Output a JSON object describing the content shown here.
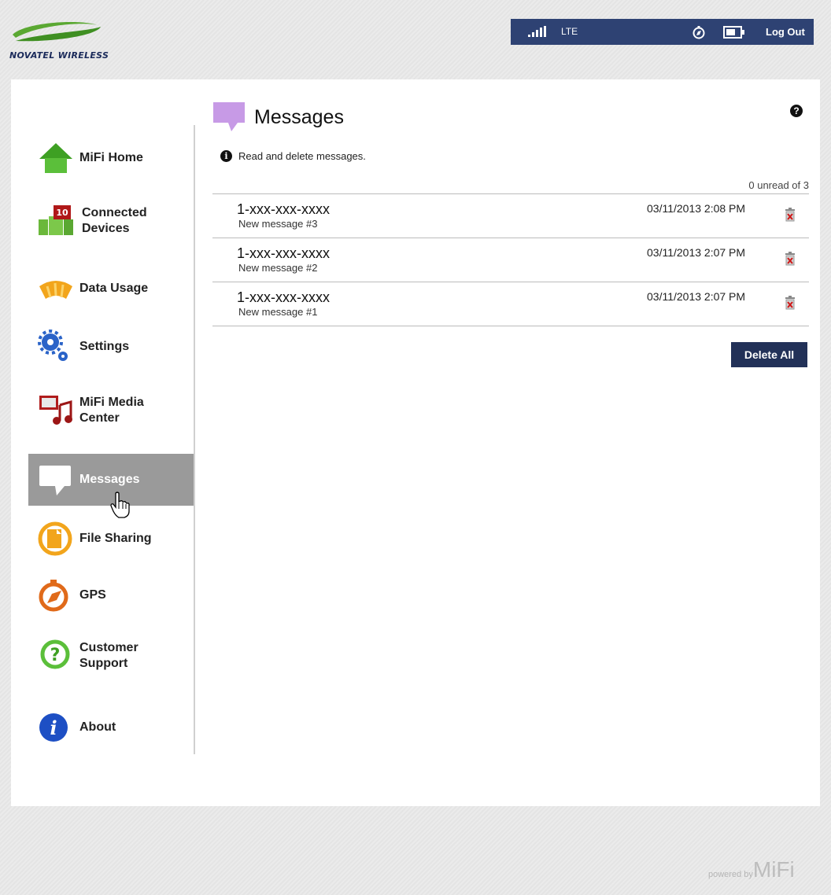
{
  "brand": {
    "logo_text": "NOVATEL WIRELESS",
    "powered_by": "powered by",
    "product": "MiFi"
  },
  "topbar": {
    "network": "LTE",
    "logout_label": "Log Out",
    "icons": [
      "signal-icon",
      "gps-compass-icon",
      "battery-icon"
    ]
  },
  "sidebar": {
    "items": [
      {
        "label": "MiFi Home",
        "icon": "home-icon"
      },
      {
        "label": "Connected Devices",
        "icon": "connected-devices-icon",
        "badge": "10"
      },
      {
        "label": "Data Usage",
        "icon": "data-usage-icon"
      },
      {
        "label": "Settings",
        "icon": "settings-gears-icon"
      },
      {
        "label": "MiFi Media Center",
        "icon": "media-center-icon"
      },
      {
        "label": "Messages",
        "icon": "message-bubble-icon",
        "active": true
      },
      {
        "label": "File Sharing",
        "icon": "file-sharing-icon"
      },
      {
        "label": "GPS",
        "icon": "gps-compass-icon"
      },
      {
        "label": "Customer Support",
        "icon": "support-question-icon"
      },
      {
        "label": "About",
        "icon": "info-icon"
      }
    ]
  },
  "main": {
    "title": "Messages",
    "info_text": "Read and delete messages.",
    "unread_summary": "0 unread of 3",
    "messages": [
      {
        "from": "1-xxx-xxx-xxxx",
        "snippet": "New message #3",
        "time": "03/11/2013 2:08 PM"
      },
      {
        "from": "1-xxx-xxx-xxxx",
        "snippet": "New message #2",
        "time": "03/11/2013 2:07 PM"
      },
      {
        "from": "1-xxx-xxx-xxxx",
        "snippet": "New message #1",
        "time": "03/11/2013 2:07 PM"
      }
    ],
    "delete_all_label": "Delete All"
  },
  "colors": {
    "topbar_bg": "#2e4273",
    "button_bg": "#223158",
    "active_nav_bg": "#9a9a9a",
    "accent_purple": "#b98ad9"
  }
}
